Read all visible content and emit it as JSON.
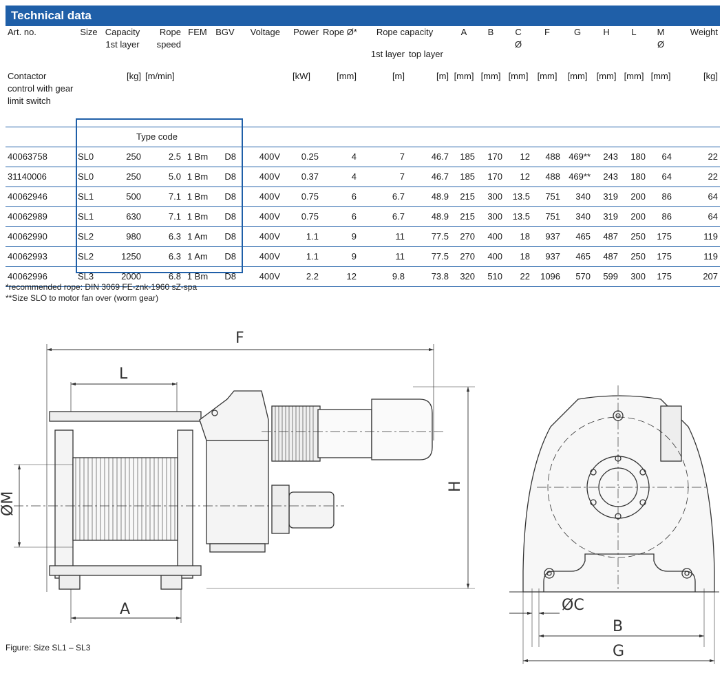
{
  "title": "Technical data",
  "headers": {
    "art_no": "Art. no.",
    "size": "Size",
    "capacity": "Capacity",
    "capacity_sub": "1st layer",
    "rope_speed_1": "Rope",
    "rope_speed_2": "speed",
    "fem": "FEM",
    "bgv": "BGV",
    "voltage": "Voltage",
    "power": "Power",
    "rope_dia": "Rope Ø*",
    "rope_capacity": "Rope capacity",
    "rope_cap_first": "1st layer",
    "rope_cap_top": "top layer",
    "A": "A",
    "B": "B",
    "C": "C",
    "C_sub": "Ø",
    "F": "F",
    "G": "G",
    "H": "H",
    "L": "L",
    "M": "M",
    "M_sub": "Ø",
    "weight": "Weight"
  },
  "units": {
    "art_no": "Contactor control with gear limit switch",
    "capacity": "[kg]",
    "rope_speed": "[m/min]",
    "power": "[kW]",
    "rope_dia": "[mm]",
    "rope_cap_first": "[m]",
    "rope_cap_top": "[m]",
    "A": "[mm]",
    "B": "[mm]",
    "C": "[mm]",
    "F": "[mm]",
    "G": "[mm]",
    "H": "[mm]",
    "L": "[mm]",
    "M": "[mm]",
    "weight": "[kg]"
  },
  "type_code_label": "Type code",
  "rows": [
    {
      "art": "40063758",
      "size": "SL0",
      "cap": "250",
      "speed": "2.5",
      "fem": "1 Bm",
      "bgv": "D8",
      "volt": "400V",
      "power": "0.25",
      "rope": "4",
      "rc1": "7",
      "rct": "46.7",
      "A": "185",
      "B": "170",
      "C": "12",
      "F": "488",
      "G": "469**",
      "H": "243",
      "L": "180",
      "M": "64",
      "weight": "22"
    },
    {
      "art": "31140006",
      "size": "SL0",
      "cap": "250",
      "speed": "5.0",
      "fem": "1 Bm",
      "bgv": "D8",
      "volt": "400V",
      "power": "0.37",
      "rope": "4",
      "rc1": "7",
      "rct": "46.7",
      "A": "185",
      "B": "170",
      "C": "12",
      "F": "488",
      "G": "469**",
      "H": "243",
      "L": "180",
      "M": "64",
      "weight": "22"
    },
    {
      "art": "40062946",
      "size": "SL1",
      "cap": "500",
      "speed": "7.1",
      "fem": "1 Bm",
      "bgv": "D8",
      "volt": "400V",
      "power": "0.75",
      "rope": "6",
      "rc1": "6.7",
      "rct": "48.9",
      "A": "215",
      "B": "300",
      "C": "13.5",
      "F": "751",
      "G": "340",
      "H": "319",
      "L": "200",
      "M": "86",
      "weight": "64"
    },
    {
      "art": "40062989",
      "size": "SL1",
      "cap": "630",
      "speed": "7.1",
      "fem": "1 Bm",
      "bgv": "D8",
      "volt": "400V",
      "power": "0.75",
      "rope": "6",
      "rc1": "6.7",
      "rct": "48.9",
      "A": "215",
      "B": "300",
      "C": "13.5",
      "F": "751",
      "G": "340",
      "H": "319",
      "L": "200",
      "M": "86",
      "weight": "64"
    },
    {
      "art": "40062990",
      "size": "SL2",
      "cap": "980",
      "speed": "6.3",
      "fem": "1 Am",
      "bgv": "D8",
      "volt": "400V",
      "power": "1.1",
      "rope": "9",
      "rc1": "11",
      "rct": "77.5",
      "A": "270",
      "B": "400",
      "C": "18",
      "F": "937",
      "G": "465",
      "H": "487",
      "L": "250",
      "M": "175",
      "weight": "119"
    },
    {
      "art": "40062993",
      "size": "SL2",
      "cap": "1250",
      "speed": "6.3",
      "fem": "1 Am",
      "bgv": "D8",
      "volt": "400V",
      "power": "1.1",
      "rope": "9",
      "rc1": "11",
      "rct": "77.5",
      "A": "270",
      "B": "400",
      "C": "18",
      "F": "937",
      "G": "465",
      "H": "487",
      "L": "250",
      "M": "175",
      "weight": "119"
    },
    {
      "art": "40062996",
      "size": "SL3",
      "cap": "2000",
      "speed": "6.8",
      "fem": "1 Bm",
      "bgv": "D8",
      "volt": "400V",
      "power": "2.2",
      "rope": "12",
      "rc1": "9.8",
      "rct": "73.8",
      "A": "320",
      "B": "510",
      "C": "22",
      "F": "1096",
      "G": "570",
      "H": "599",
      "L": "300",
      "M": "175",
      "weight": "207"
    }
  ],
  "notes": {
    "note1": "*recommended rope: DIN 3069 FE-znk-1960 sZ-spa",
    "note2": "**Size SLO to motor fan over (worm gear)"
  },
  "drawing": {
    "dim_F": "F",
    "dim_L": "L",
    "dim_A": "A",
    "dim_H": "H",
    "dim_M": "ØM",
    "dim_C": "ØC",
    "dim_B": "B",
    "dim_G": "G"
  },
  "caption": "Figure: Size SL1 – SL3"
}
